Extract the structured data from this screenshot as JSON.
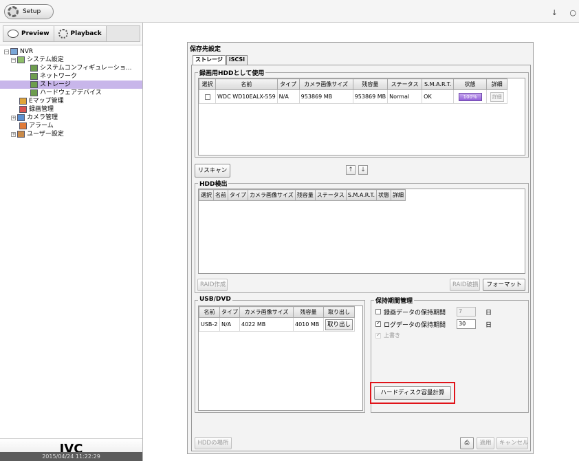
{
  "topbar": {
    "setup_tab": "Setup",
    "icon_right_1": "↓",
    "icon_right_2": "○"
  },
  "modes": {
    "preview": "Preview",
    "playback": "Playback"
  },
  "tree": {
    "nvr": "NVR",
    "system_settings": "システム設定",
    "system_config": "システムコンフィギュレーショ...",
    "network": "ネットワーク",
    "storage": "ストレージ",
    "hardware_devices": "ハードウェアデバイス",
    "emap": "Eマップ管理",
    "recording": "録画管理",
    "camera": "カメラ管理",
    "alarm": "アラーム",
    "user_settings": "ユーザー設定"
  },
  "brand": "JVC",
  "clock": "2015/04/24 11:22:29",
  "panel": {
    "title": "保存先設定",
    "tabs": [
      "ストレージ",
      "iSCSI"
    ]
  },
  "hdd_used": {
    "legend": "録画用HDDとして使用",
    "columns": [
      "選択",
      "名前",
      "タイプ",
      "カメラ画像サイズ",
      "残容量",
      "ステータス",
      "S.M.A.R.T.",
      "状態",
      "詳細"
    ],
    "rows": [
      {
        "name": "WDC WD10EALX-559",
        "type": "N/A",
        "size": "953869 MB",
        "remaining": "953869 MB",
        "status": "Normal",
        "smart": "OK",
        "state": "100%",
        "detail": "詳細"
      }
    ]
  },
  "rescan_label": "リスキャン",
  "arrows": {
    "up": "↑",
    "down": "↓"
  },
  "hdd_detect": {
    "legend": "HDD検出",
    "columns": [
      "選択",
      "名前",
      "タイプ",
      "カメラ画像サイズ",
      "残容量",
      "ステータス",
      "S.M.A.R.T.",
      "状態",
      "詳細"
    ],
    "raid_create": "RAID作成",
    "raid_destroy": "RAID破損",
    "format": "フォーマット"
  },
  "usb": {
    "legend": "USB/DVD",
    "columns": [
      "名前",
      "タイプ",
      "カメラ画像サイズ",
      "残容量",
      "取り出し"
    ],
    "rows": [
      {
        "name": "USB-2",
        "type": "N/A",
        "size": "4022 MB",
        "remaining": "4010 MB",
        "eject": "取り出し"
      }
    ]
  },
  "retention": {
    "legend": "保持期間管理",
    "rec_label": "録画データの保持期間",
    "rec_value": "7",
    "rec_unit": "日",
    "rec_checked": false,
    "log_label": "ログデータの保持期間",
    "log_value": "30",
    "log_unit": "日",
    "log_checked": true,
    "overwrite_label": "上書き",
    "calc_button": "ハードディスク容量計算"
  },
  "footer": {
    "hdd_location": "HDDの場所",
    "print_icon": "⎙",
    "apply": "適用",
    "cancel": "キャンセル"
  }
}
